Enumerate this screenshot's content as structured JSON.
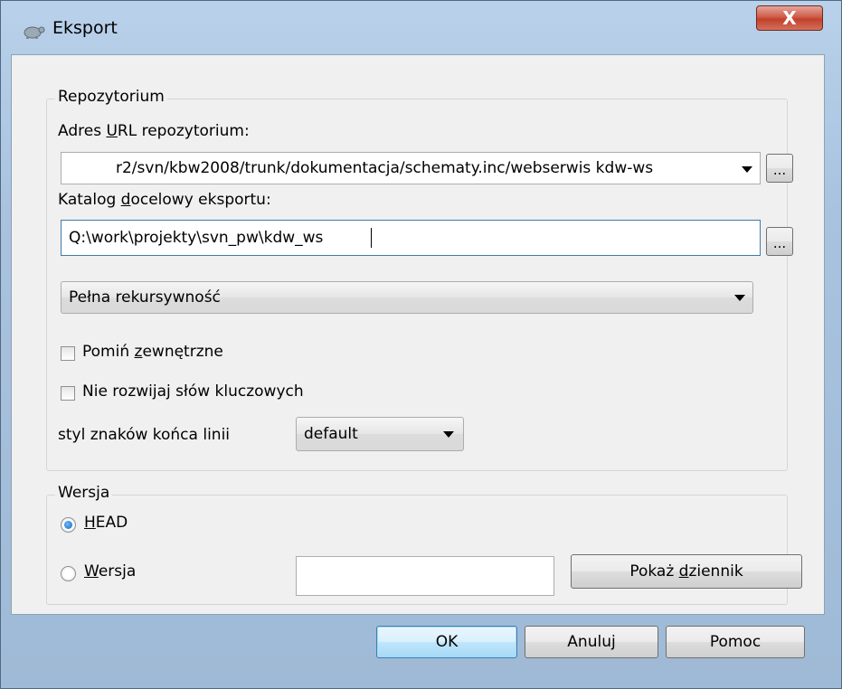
{
  "window": {
    "title": "Eksport",
    "close_label": "X"
  },
  "repository": {
    "legend": "Repozytorium",
    "url_label_pre": "Adres ",
    "url_label_u": "U",
    "url_label_post": "RL repozytorium:",
    "url_value": "r2/svn/kbw2008/trunk/dokumentacja/schematy.inc/webserwis kdw-ws",
    "browse_label": "...",
    "target_label_pre": "Katalog ",
    "target_label_u": "d",
    "target_label_post": "ocelowy eksportu:",
    "target_value": "Q:\\work\\projekty\\svn_pw\\kdw_ws",
    "depth_value": "Pełna rekursywność",
    "omit_externals_pre": "Pomiń ",
    "omit_externals_u": "z",
    "omit_externals_post": "ewnętrzne",
    "omit_externals_checked": false,
    "no_keywords_label": "Nie rozwijaj słów kluczowych",
    "no_keywords_checked": false,
    "eol_label": "styl znaków końca linii",
    "eol_value": "default"
  },
  "revision": {
    "legend": "Wersja",
    "head_u": "H",
    "head_rest": "EAD",
    "head_selected": true,
    "rev_u": "W",
    "rev_rest": "ersja",
    "rev_selected": false,
    "rev_value": "",
    "show_log_pre": "Pokaż ",
    "show_log_u": "d",
    "show_log_post": "ziennik"
  },
  "buttons": {
    "ok": "OK",
    "cancel": "Anuluj",
    "help": "Pomoc"
  }
}
